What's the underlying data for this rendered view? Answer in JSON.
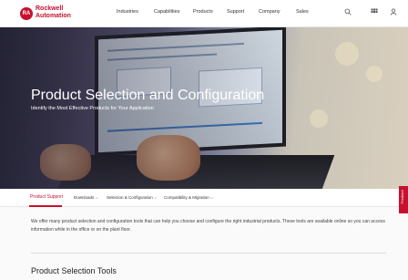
{
  "brand": {
    "logo_mark": "RA",
    "name_line1": "Rockwell",
    "name_line2": "Automation",
    "color": "#c8102e"
  },
  "nav": [
    "Industries",
    "Capabilities",
    "Products",
    "Support",
    "Company",
    "Sales"
  ],
  "header_icons": [
    "search-icon",
    "grid-icon",
    "user-icon"
  ],
  "hero": {
    "title": "Product Selection and Configuration",
    "subtitle": "Identify the Most Effective Products for Your Application"
  },
  "subnav": {
    "active": "Product Support",
    "items": [
      "Downloads",
      "Selection & Configuration",
      "Compatibility & Migration"
    ]
  },
  "feedback_label": "Feedback",
  "intro": "We offer many product selection and configuration tools that can help you choose and configure the right industrial products. These tools are available online so you can access information while in the office or on the plant floor.",
  "section_title": "Product Selection Tools"
}
